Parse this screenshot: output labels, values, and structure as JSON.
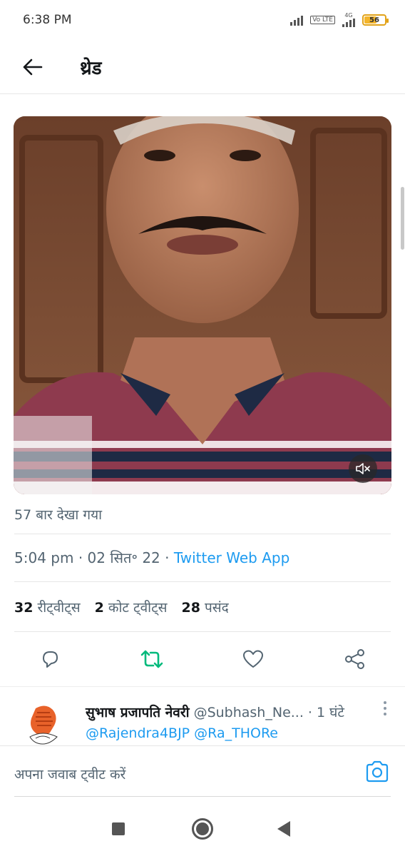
{
  "status_bar": {
    "time": "6:38 PM",
    "network_label": "4G",
    "volte_label": "Vo LTE",
    "battery": "56"
  },
  "header": {
    "title": "थ्रेड"
  },
  "tweet": {
    "views": "57 बार देखा गया",
    "time": "5:04 pm",
    "date": "02 सित॰ 22",
    "source": "Twitter Web App",
    "retweets": "32",
    "retweets_label": "रीट्वीट्स",
    "quotes": "2",
    "quotes_label": "कोट ट्वीट्स",
    "likes": "28",
    "likes_label": "पसंद"
  },
  "reply": {
    "name": "सुभाष प्रजापति नेवरी",
    "handle": "@Subhash_Ne...",
    "time": "1 घंटे",
    "text": "@Rajendra4BJP @Ra_THORe"
  },
  "compose": {
    "placeholder": "अपना जवाब ट्वीट करें"
  },
  "colors": {
    "accent": "#1d9bf0",
    "retweet": "#00ba7c",
    "muted": "#536471"
  }
}
